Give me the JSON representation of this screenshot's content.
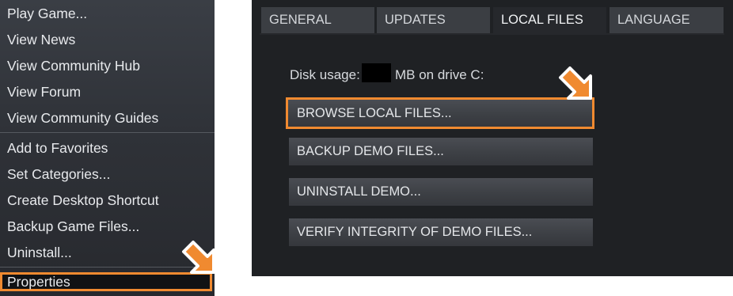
{
  "context_menu": {
    "group1": [
      "Play Game...",
      "View News",
      "View Community Hub",
      "View Forum",
      "View Community Guides"
    ],
    "group2": [
      "Add to Favorites",
      "Set Categories...",
      "Create Desktop Shortcut",
      "Backup Game Files...",
      "Uninstall..."
    ],
    "properties": "Properties"
  },
  "properties_panel": {
    "tabs": [
      "GENERAL",
      "UPDATES",
      "LOCAL FILES",
      "LANGUAGE"
    ],
    "active_tab": "LOCAL FILES",
    "disk_usage_prefix": "Disk usage:",
    "disk_usage_suffix": "MB on drive C:",
    "buttons": [
      "BROWSE LOCAL FILES...",
      "BACKUP DEMO FILES...",
      "UNINSTALL DEMO...",
      "VERIFY INTEGRITY OF DEMO FILES..."
    ]
  },
  "colors": {
    "highlight": "#f08a30",
    "menu_bg": "#2f3238",
    "panel_bg": "#1f2124",
    "button_bg": "#3d4045"
  }
}
